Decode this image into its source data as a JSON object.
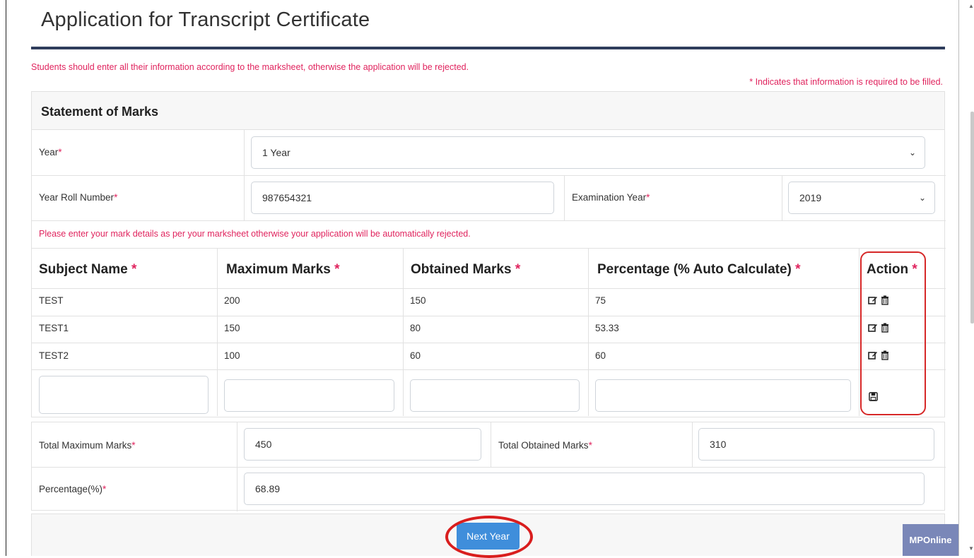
{
  "page": {
    "title": "Application for Transcript Certificate",
    "notice": "Students should enter all their information according to the marksheet, otherwise the application will be rejected.",
    "required_note": "* Indicates that information is required to be filled."
  },
  "statement": {
    "heading": "Statement of Marks",
    "year_label": "Year",
    "year_value": "1 Year",
    "roll_label": "Year Roll Number",
    "roll_value": "987654321",
    "exam_year_label": "Examination Year",
    "exam_year_value": "2019",
    "marks_notice": "Please enter your mark details as per your marksheet otherwise your application will be automatically rejected."
  },
  "marks_table": {
    "headers": {
      "subject": "Subject Name",
      "maximum": "Maximum Marks",
      "obtained": "Obtained Marks",
      "percentage": "Percentage (% Auto Calculate)",
      "action": "Action"
    },
    "rows": [
      {
        "subject": "TEST",
        "maximum": "200",
        "obtained": "150",
        "percentage": "75"
      },
      {
        "subject": "TEST1",
        "maximum": "150",
        "obtained": "80",
        "percentage": "53.33"
      },
      {
        "subject": "TEST2",
        "maximum": "100",
        "obtained": "60",
        "percentage": "60"
      }
    ],
    "icons": {
      "edit": "edit-icon",
      "delete": "trash-icon",
      "save": "save-icon"
    }
  },
  "totals": {
    "max_label": "Total Maximum Marks",
    "max_value": "450",
    "obtained_label": "Total Obtained Marks",
    "obtained_value": "310",
    "percentage_label": "Percentage(%)",
    "percentage_value": "68.89"
  },
  "footer": {
    "next_button": "Next Year",
    "brand_badge": "MPOnline"
  },
  "colors": {
    "required": "#e0245e",
    "title_rule": "#2f3d5c",
    "button": "#3f8edb",
    "highlight": "#d62828",
    "badge": "#7a87b8"
  }
}
